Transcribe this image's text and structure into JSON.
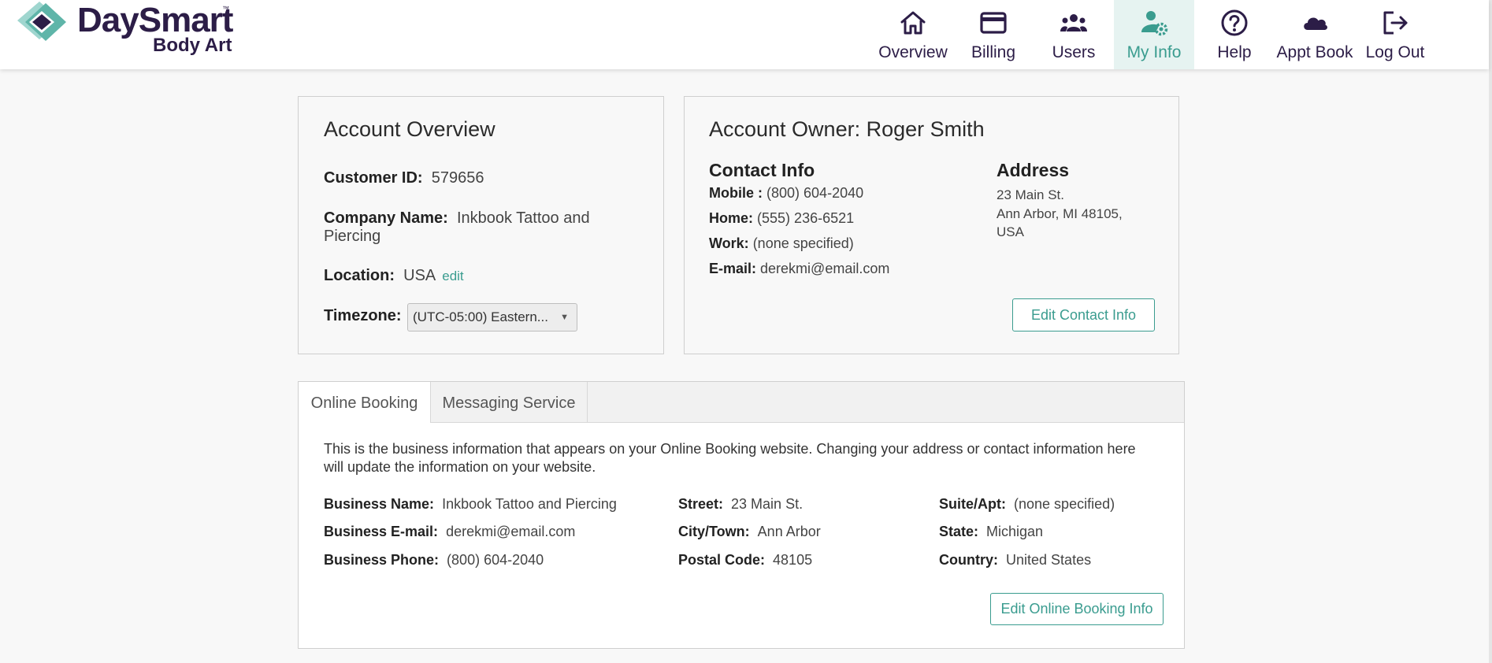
{
  "brand": {
    "name": "DaySmart",
    "tm": "™",
    "sub": "Body Art",
    "color": "#2c1d47",
    "accent": "#3a9c8f"
  },
  "nav": [
    {
      "label": "Overview",
      "icon": "home-icon"
    },
    {
      "label": "Billing",
      "icon": "credit-card-icon"
    },
    {
      "label": "Users",
      "icon": "users-icon"
    },
    {
      "label": "My Info",
      "icon": "user-gear-icon",
      "active": true
    },
    {
      "label": "Help",
      "icon": "help-icon"
    },
    {
      "label": "Appt Book",
      "icon": "cloud-icon"
    },
    {
      "label": "Log Out",
      "icon": "logout-icon"
    }
  ],
  "overview": {
    "title": "Account Overview",
    "customer_id_label": "Customer ID:",
    "customer_id": "579656",
    "company_label": "Company Name:",
    "company_line1": "Inkbook Tattoo and",
    "company_line2": "Piercing",
    "location_label": "Location:",
    "location": "USA",
    "location_edit": "edit",
    "timezone_label": "Timezone:",
    "timezone": "(UTC-05:00) Eastern..."
  },
  "owner": {
    "title": "Account Owner: Roger Smith",
    "contact_title": "Contact Info",
    "mobile_label": "Mobile :",
    "mobile": "(800) 604-2040",
    "home_label": "Home:",
    "home": "(555) 236-6521",
    "work_label": "Work:",
    "work": "(none specified)",
    "email_label": "E-mail:",
    "email": "derekmi@email.com",
    "address_title": "Address",
    "address_line1": "23 Main St.",
    "address_line2": "Ann Arbor, MI 48105,",
    "address_line3": "USA",
    "edit_button": "Edit Contact Info"
  },
  "tabs": {
    "items": [
      "Online Booking",
      "Messaging Service"
    ],
    "description": "This is the business information that appears on your Online Booking website. Changing your address or contact information here will update the information on your website.",
    "business_name_label": "Business Name:",
    "business_name": "Inkbook Tattoo and Piercing",
    "business_email_label": "Business E-mail:",
    "business_email": "derekmi@email.com",
    "business_phone_label": "Business Phone:",
    "business_phone": "(800) 604-2040",
    "street_label": "Street:",
    "street": "23 Main St.",
    "city_label": "City/Town:",
    "city": "Ann Arbor",
    "postal_label": "Postal Code:",
    "postal": "48105",
    "suite_label": "Suite/Apt:",
    "suite": "(none specified)",
    "state_label": "State:",
    "state": "Michigan",
    "country_label": "Country:",
    "country": "United States",
    "edit_button": "Edit Online Booking Info"
  }
}
